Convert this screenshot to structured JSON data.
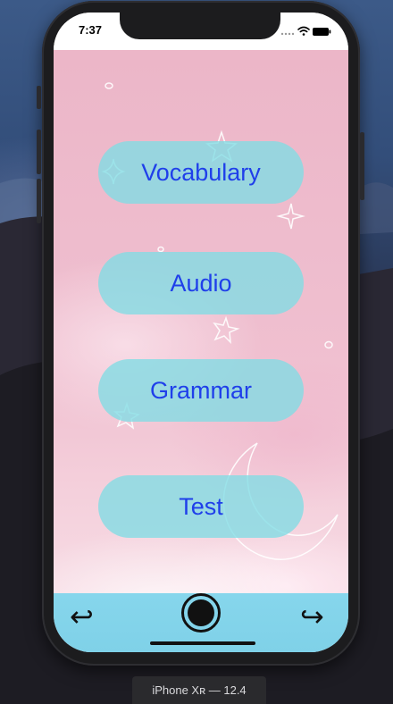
{
  "status_bar": {
    "time": "7:37"
  },
  "menu": {
    "items": [
      {
        "label": "Vocabulary"
      },
      {
        "label": "Audio"
      },
      {
        "label": "Grammar"
      },
      {
        "label": "Test"
      }
    ]
  },
  "bottom_bar": {
    "back_icon": "↩",
    "forward_icon": "↪"
  },
  "simulator": {
    "device_label": "iPhone Xʀ — 12.4"
  },
  "colors": {
    "button_fill": "#80dce4",
    "button_text": "#1f3fea",
    "bottom_bar": "#86d6ec",
    "background_pink": "#eebccd"
  },
  "icons": {
    "back": "undo-arrow-icon",
    "forward": "redo-arrow-icon",
    "home": "home-button-icon",
    "wifi": "wifi-icon",
    "battery": "battery-icon",
    "signal": "signal-icon"
  }
}
